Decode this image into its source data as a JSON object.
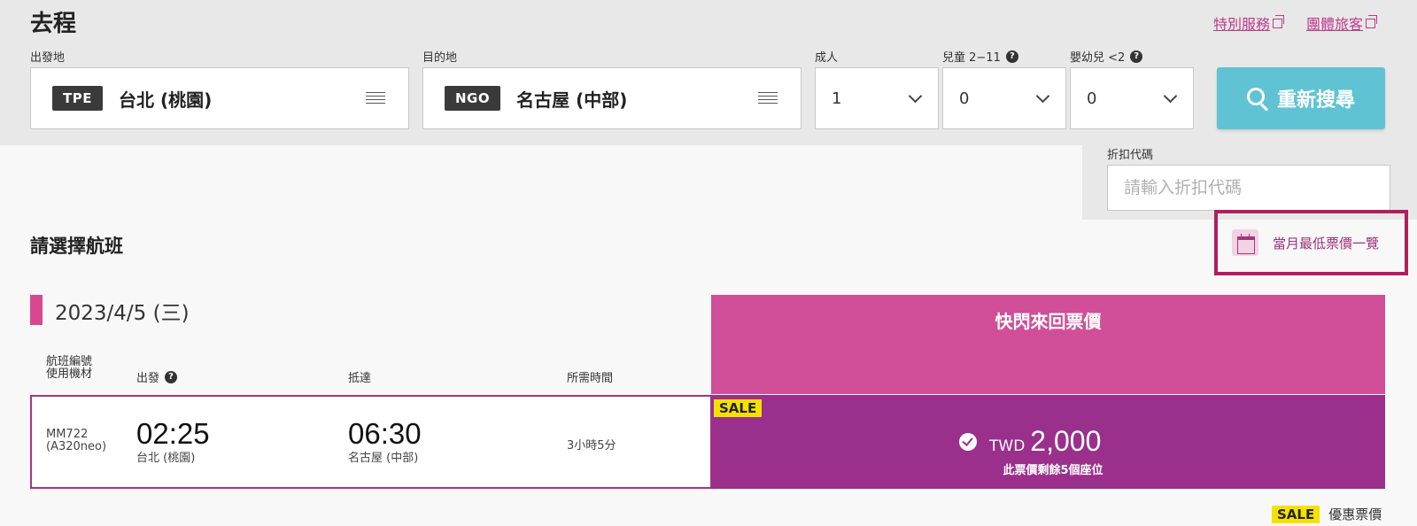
{
  "header": {
    "title": "去程",
    "special_service_link": "特別服務",
    "group_travel_link": "團體旅客"
  },
  "search": {
    "origin_label": "出發地",
    "origin_code": "TPE",
    "origin_name": "台北 (桃園)",
    "destination_label": "目的地",
    "destination_code": "NGO",
    "destination_name": "名古屋 (中部)",
    "adults_label": "成人",
    "adults_value": "1",
    "children_label": "兒童 2−11",
    "children_value": "0",
    "infants_label": "嬰幼兒 <2",
    "infants_value": "0",
    "search_button": "重新搜尋",
    "promo_label": "折扣代碼",
    "promo_placeholder": "請輸入折扣代碼"
  },
  "results": {
    "title": "請選擇航班",
    "lowest_fare_link": "當月最低票價一覽",
    "date": "2023/4/5 (三)",
    "fare_column_title": "快閃來回票價",
    "columns": {
      "flight_no_line1": "航班編號",
      "flight_no_line2": "使用機材",
      "departure": "出發",
      "arrival": "抵達",
      "duration": "所需時間"
    },
    "flights": [
      {
        "number": "MM722",
        "aircraft": "(A320neo)",
        "dep_time": "02:25",
        "dep_airport": "台北 (桃園)",
        "arr_time": "06:30",
        "arr_airport": "名古屋 (中部)",
        "duration": "3小時5分",
        "badge": "SALE",
        "currency": "TWD",
        "price": "2,000",
        "seats_left": "此票價剩餘5個座位"
      }
    ],
    "legend_badge": "SALE",
    "legend_label": "優惠票價"
  },
  "colors": {
    "accent": "#d14f98",
    "fare_cell": "#9b2f8c",
    "search_button": "#5fc3d4",
    "sale_badge": "#f5e100",
    "highlight_border": "#b01e5e"
  }
}
